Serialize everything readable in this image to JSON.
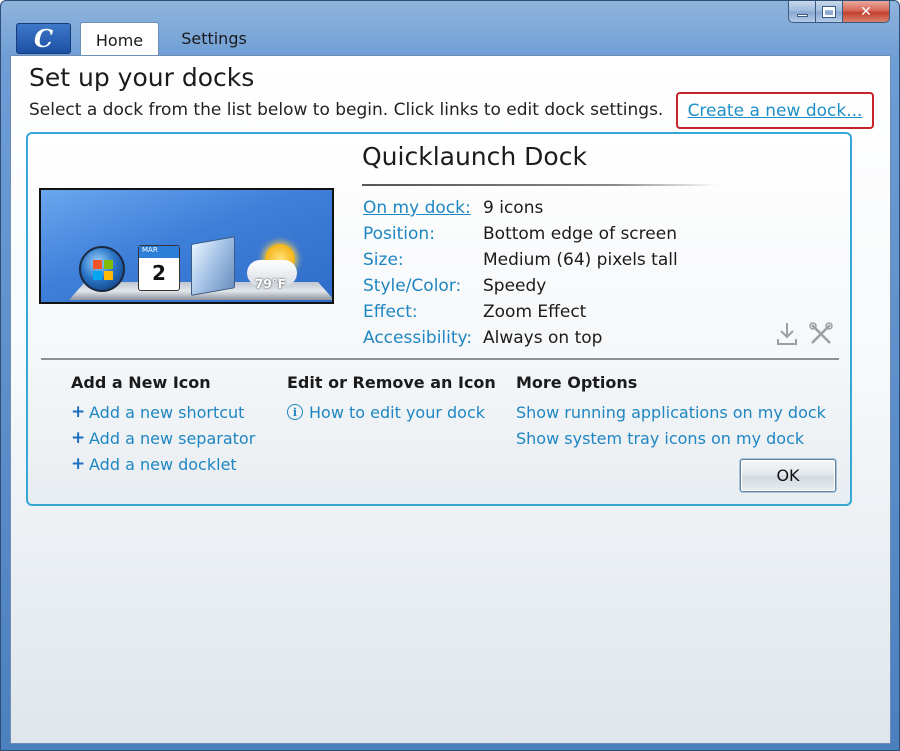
{
  "window": {
    "minimize_glyph": "",
    "maximize_glyph": "",
    "close_glyph": "✕"
  },
  "app": {
    "logo_glyph": "C"
  },
  "tabs": [
    {
      "label": "Home",
      "selected": true
    },
    {
      "label": "Settings",
      "selected": false
    }
  ],
  "header": {
    "title": "Set up your docks",
    "subtitle": "Select a dock from the list below to begin. Click links to edit dock settings.",
    "create_link": "Create a new dock..."
  },
  "dock": {
    "name": "Quicklaunch Dock",
    "preview": {
      "calendar_month": "MAR",
      "calendar_day": "2",
      "temperature": "79°F"
    },
    "properties": [
      {
        "label": "On my dock:",
        "value": "9 icons",
        "is_link": true
      },
      {
        "label": "Position:",
        "value": "Bottom edge of screen",
        "is_link": false
      },
      {
        "label": "Size:",
        "value": "Medium (64) pixels tall",
        "is_link": false
      },
      {
        "label": "Style/Color:",
        "value": "Speedy",
        "is_link": false
      },
      {
        "label": "Effect:",
        "value": "Zoom Effect",
        "is_link": false
      },
      {
        "label": "Accessibility:",
        "value": "Always on top",
        "is_link": false
      }
    ],
    "icons": {
      "export": "download-icon",
      "delete": "tools-delete-icon"
    }
  },
  "sections": {
    "add_icon": {
      "heading": "Add a New Icon",
      "links": [
        "Add a new shortcut",
        "Add a new separator",
        "Add a new docklet"
      ]
    },
    "edit_icon": {
      "heading": "Edit or Remove an Icon",
      "links": [
        "How to edit your dock"
      ]
    },
    "more_options": {
      "heading": "More Options",
      "links": [
        "Show running applications on my dock",
        "Show system tray icons on my dock"
      ]
    }
  },
  "buttons": {
    "ok": "OK"
  },
  "colors": {
    "link": "#1e86c2",
    "highlight_border": "#c8222a",
    "panel_border": "#35a8d6",
    "frame": "#5a8cc8"
  }
}
